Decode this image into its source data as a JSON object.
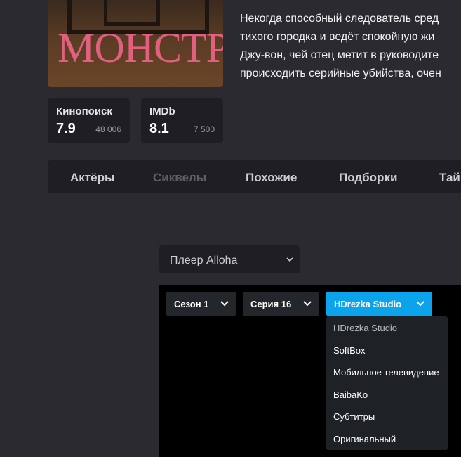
{
  "poster": {
    "title": "МОНСТР"
  },
  "description": [
    "Некогда способный следователь сред",
    "тихого городка и ведёт спокойную жи",
    "Джу-вон, чей отец метит в руководите",
    "происходить серийные убийства, очен"
  ],
  "ratings": [
    {
      "name": "Кинопоиск",
      "value": "7.9",
      "count": "48 006"
    },
    {
      "name": "IMDb",
      "value": "8.1",
      "count": "7 500"
    }
  ],
  "tabs": [
    {
      "label": "Актёры",
      "dim": false
    },
    {
      "label": "Сиквелы",
      "dim": true
    },
    {
      "label": "Похожие",
      "dim": false
    },
    {
      "label": "Подборки",
      "dim": false
    },
    {
      "label": "Тайм",
      "dim": false
    }
  ],
  "player_select": {
    "label": "Плеер Alloha",
    "icon": "chevron-down-icon"
  },
  "player": {
    "season": "Сезон 1",
    "episode": "Серия 16",
    "voice": "HDrezka Studio",
    "accent": "#0aa3ec",
    "voice_options": [
      "HDrezka Studio",
      "SoftBox",
      "Мобильное телевидение",
      "BaibaKo",
      "Субтитры",
      "Оригинальный"
    ]
  }
}
